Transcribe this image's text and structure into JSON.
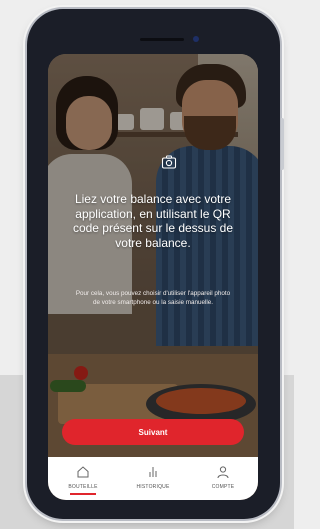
{
  "onboarding": {
    "headline": "Liez votre balance avec votre application, en utilisant le QR code présent sur le dessus de votre balance.",
    "subtext": "Pour cela, vous pouvez choisir d'utiliser l'appareil photo de votre smartphone ou la saisie manuelle.",
    "next_button": "Suivant",
    "icon": "camera-icon"
  },
  "tabbar": {
    "items": [
      {
        "label": "BOUTEILLE",
        "icon": "home-icon",
        "active": true
      },
      {
        "label": "HISTORIQUE",
        "icon": "bar-chart-icon",
        "active": false
      },
      {
        "label": "COMPTE",
        "icon": "user-icon",
        "active": false
      }
    ]
  },
  "colors": {
    "accent": "#e0252c",
    "tabbar_bg": "#ffffff",
    "text_light": "#ffffff"
  }
}
